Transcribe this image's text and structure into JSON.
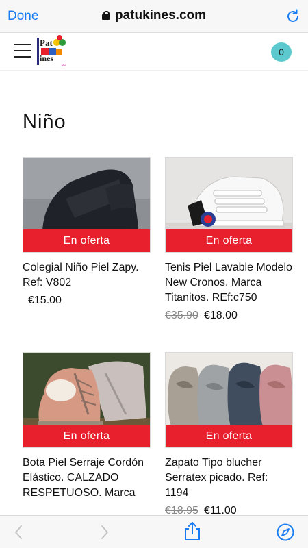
{
  "browser": {
    "done_label": "Done",
    "url": "patukines.com",
    "accent_color": "#1a7cf2"
  },
  "header": {
    "menu_icon": "hamburger-icon",
    "logo_name": "Patukines logo",
    "cart_count": "0"
  },
  "page": {
    "title": "Niño"
  },
  "products": [
    {
      "image": "black velcro school shoe",
      "badge": "En oferta",
      "title": "Colegial Niño Piel Zapy. Ref: V802",
      "old_price": "",
      "price": "€15.00"
    },
    {
      "image": "white velcro sneaker",
      "badge": "En oferta",
      "title": "Tenis Piel Lavable Modelo New Cronos. Marca Titanitos. REf:c750",
      "old_price": "€35.90",
      "price": "€18.00"
    },
    {
      "image": "suede lace-up boots",
      "badge": "En oferta",
      "title": "Bota Piel Serraje Cordón Elástico. CALZADO RESPETUOSO. Marca",
      "old_price": "",
      "price": ""
    },
    {
      "image": "suede bluchers with ribbon laces",
      "badge": "En oferta",
      "title": "Zapato Tipo blucher Serratex picado. Ref: 1194",
      "old_price": "€18.95",
      "price": "€11.00"
    }
  ],
  "colors": {
    "sale_red": "#e8202e",
    "cart_teal": "#5cc9cf"
  },
  "toolbar": {
    "back_icon": "chevron-left-icon",
    "forward_icon": "chevron-right-icon",
    "share_icon": "share-icon",
    "safari_icon": "compass-icon"
  }
}
